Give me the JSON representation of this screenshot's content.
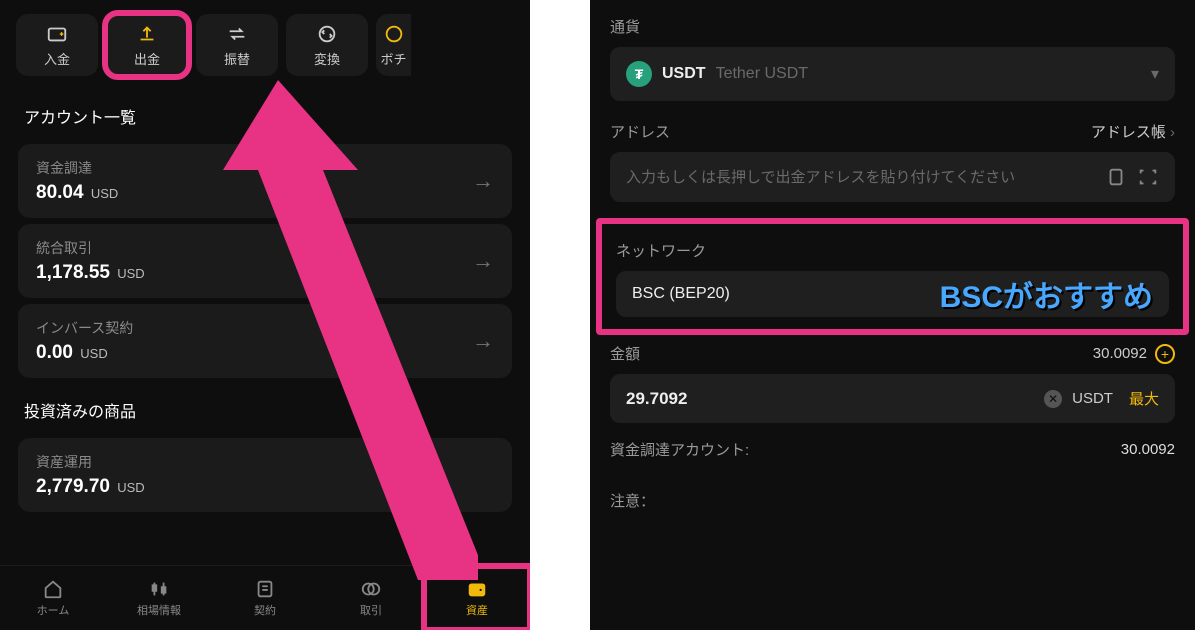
{
  "left": {
    "actions": {
      "deposit": "入金",
      "withdraw": "出金",
      "transfer": "振替",
      "convert": "変換",
      "voucher": "ボチ"
    },
    "accounts_title": "アカウント一覧",
    "accounts": [
      {
        "label": "資金調達",
        "value": "80.04",
        "currency": "USD"
      },
      {
        "label": "統合取引",
        "value": "1,178.55",
        "currency": "USD"
      },
      {
        "label": "インバース契約",
        "value": "0.00",
        "currency": "USD"
      }
    ],
    "invested_title": "投資済みの商品",
    "invested": {
      "label": "資産運用",
      "value": "2,779.70",
      "currency": "USD"
    },
    "tabs": {
      "home": "ホーム",
      "markets": "相場情報",
      "contracts": "契約",
      "trade": "取引",
      "assets": "資産"
    }
  },
  "right": {
    "currency_label": "通貨",
    "token_symbol": "USDT",
    "token_name": "Tether USDT",
    "address_label": "アドレス",
    "address_book": "アドレス帳",
    "address_placeholder": "入力もしくは長押しで出金アドレスを貼り付けてください",
    "network_label": "ネットワーク",
    "network_value": "BSC (BEP20)",
    "callout": "BSCがおすすめ",
    "amount_label": "金額",
    "amount_available": "30.0092",
    "amount_value": "29.7092",
    "amount_unit": "USDT",
    "amount_max": "最大",
    "funding_label": "資金調達アカウント:",
    "funding_value": "30.0092",
    "note_label": "注意："
  }
}
